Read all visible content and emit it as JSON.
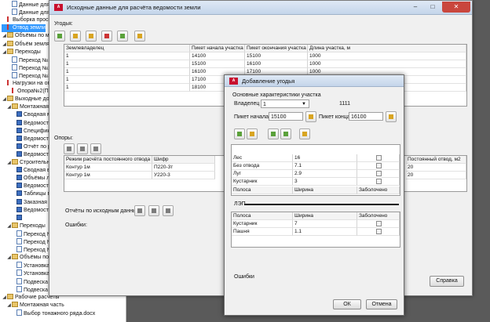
{
  "tree": {
    "items": [
      {
        "label": "Данные для монтажных таблиц - Расчёт по",
        "indent": 1,
        "icon": "doc"
      },
      {
        "label": "Данные для монтажн...",
        "indent": 1,
        "icon": "doc"
      },
      {
        "label": "Выборка просеки",
        "indent": 0,
        "icon": "tower"
      },
      {
        "label": "Отвод земли",
        "indent": 0,
        "icon": "tower",
        "selected": true
      },
      {
        "label": "Объёмы по монтажу",
        "indent": 0,
        "icon": "fold"
      },
      {
        "label": "Объём земляных ра",
        "indent": 0,
        "icon": "fold"
      },
      {
        "label": "Переходы",
        "indent": 0,
        "icon": "fold"
      },
      {
        "label": "Переход №1",
        "indent": 1,
        "icon": "doc"
      },
      {
        "label": "Переход №2",
        "indent": 1,
        "icon": "doc"
      },
      {
        "label": "Переход №3",
        "indent": 1,
        "icon": "doc"
      },
      {
        "label": "Нагрузки на опоры",
        "indent": 0,
        "icon": "tower"
      },
      {
        "label": "Опора№2(П220-3т",
        "indent": 1,
        "icon": "tower"
      },
      {
        "label": "Выходные документы",
        "indent": 0,
        "icon": "fold"
      },
      {
        "label": "Монтажная часть",
        "indent": 1,
        "icon": "fold"
      },
      {
        "label": "Сводная монтаж",
        "indent": 2,
        "icon": "blue"
      },
      {
        "label": "Ведомость гасит",
        "indent": 2,
        "icon": "blue"
      },
      {
        "label": "Спецификация с",
        "indent": 2,
        "icon": "blue"
      },
      {
        "label": "Ведомость гирля",
        "indent": 2,
        "icon": "blue"
      },
      {
        "label": "Отчёт по расчет",
        "indent": 2,
        "icon": "blue"
      },
      {
        "label": "Ведомость натяж",
        "indent": 2,
        "icon": "blue"
      },
      {
        "label": "Строительная часть",
        "indent": 1,
        "icon": "fold"
      },
      {
        "label": "Сводная ведомо",
        "indent": 2,
        "icon": "blue"
      },
      {
        "label": "Объёмы лесосе",
        "indent": 2,
        "icon": "blue"
      },
      {
        "label": "Ведомость отвод",
        "indent": 2,
        "icon": "blue"
      },
      {
        "label": "Таблицы промеж",
        "indent": 2,
        "icon": "blue"
      },
      {
        "label": "Заказная специ",
        "indent": 2,
        "icon": "blue"
      },
      {
        "label": "Ведомость опор",
        "indent": 2,
        "icon": "blue"
      },
      {
        "label": "",
        "indent": 2,
        "icon": "blue"
      },
      {
        "label": "Переходы",
        "indent": 1,
        "icon": "fold"
      },
      {
        "label": "Переход №1.dw",
        "indent": 2,
        "icon": "doc"
      },
      {
        "label": "Переход №2.dw",
        "indent": 2,
        "icon": "doc"
      },
      {
        "label": "Переход №3.dw",
        "indent": 2,
        "icon": "doc"
      },
      {
        "label": "Объёмы по монтажу",
        "indent": 1,
        "icon": "fold"
      },
      {
        "label": "Установка опор",
        "indent": 2,
        "icon": "doc"
      },
      {
        "label": "Установка фунда",
        "indent": 2,
        "icon": "doc"
      },
      {
        "label": "Подвеска провод",
        "indent": 2,
        "icon": "doc"
      },
      {
        "label": "Подвеска провода в пролётах.docx",
        "indent": 2,
        "icon": "doc"
      },
      {
        "label": "Рабочие расчёты",
        "indent": 0,
        "icon": "fold"
      },
      {
        "label": "Монтажная часть",
        "indent": 1,
        "icon": "fold"
      },
      {
        "label": "Выбор тонажного ряда.docx",
        "indent": 2,
        "icon": "doc"
      }
    ]
  },
  "main": {
    "title": "Исходные данные для расчёта ведомости земли",
    "ugodya_label": "Угодья:",
    "ugodya_table": {
      "columns": [
        "Землевладелец",
        "Пикет начала участка",
        "Пикет окончания участка",
        "Длина участка, м"
      ],
      "rows": [
        [
          "1",
          "14100",
          "15100",
          "1000"
        ],
        [
          "1",
          "15100",
          "16100",
          "1000"
        ],
        [
          "1",
          "16100",
          "17100",
          "1000"
        ],
        [
          "1",
          "17100",
          "18100",
          "1000"
        ],
        [
          "1",
          "18100",
          "",
          "1000"
        ]
      ]
    },
    "opory_label": "Опоры:",
    "opory_table": {
      "columns": [
        "Режим расчёта постоянного отвода",
        "Шифр"
      ],
      "right_column": "Постоянный отвод, м2",
      "rows": [
        [
          "Контур 1м",
          "П220-3т",
          "20"
        ],
        [
          "Контур 1м",
          "У220-3",
          "20"
        ]
      ]
    },
    "reports_label": "Отчёты по исходным данным:",
    "errors_label": "Ошибки:",
    "help_button": "Справка"
  },
  "sub": {
    "title": "Добавление угодья",
    "section_label": "Основные характеристики участка",
    "owner_label": "Владелец",
    "owner_value": "1",
    "owner_code": "1111",
    "start_label": "Пикет начала",
    "start_value": "15100",
    "end_label": "Пикет конца",
    "end_value": "16100",
    "land_table": {
      "columns": [
        "Полоса",
        "Ширина",
        "Заболочено"
      ],
      "rows": [
        [
          "Лес",
          "16"
        ],
        [
          "Без отвода",
          "7.1"
        ],
        [
          "Луг",
          "2.9"
        ],
        [
          "Кустарник",
          "3"
        ]
      ]
    },
    "lep_label": "ЛЭП",
    "lep_table": {
      "columns": [
        "Полоса",
        "Ширина",
        "Заболочено"
      ],
      "rows": [
        [
          "Кустарник",
          "7"
        ],
        [
          "Пашня",
          "1.1"
        ]
      ]
    },
    "errors_label": "Ошибки",
    "ok_button": "ОК",
    "cancel_button": "Отмена"
  }
}
